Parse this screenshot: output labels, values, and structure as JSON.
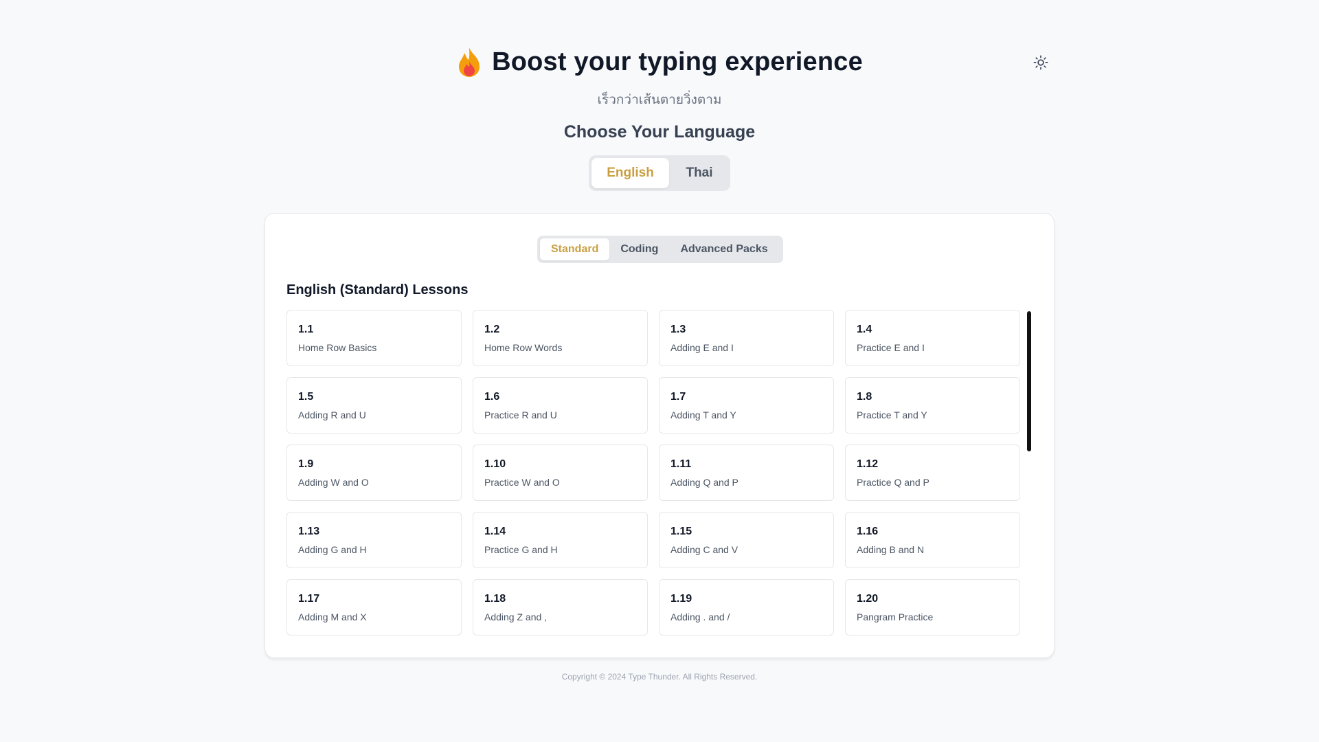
{
  "header": {
    "title": "Boost your typing experience",
    "subtitle": "เร็วกว่าเส้นตายวิ่งตาม",
    "flame_icon": "flame-icon",
    "theme_icon": "sun-icon"
  },
  "language": {
    "heading": "Choose Your Language",
    "options": [
      "English",
      "Thai"
    ],
    "selected": "English"
  },
  "categories": {
    "tabs": [
      "Standard",
      "Coding",
      "Advanced Packs"
    ],
    "selected": "Standard"
  },
  "lessons": {
    "section_title": "English (Standard) Lessons",
    "items": [
      {
        "id": "1.1",
        "title": "Home Row Basics"
      },
      {
        "id": "1.2",
        "title": "Home Row Words"
      },
      {
        "id": "1.3",
        "title": "Adding E and I"
      },
      {
        "id": "1.4",
        "title": "Practice E and I"
      },
      {
        "id": "1.5",
        "title": "Adding R and U"
      },
      {
        "id": "1.6",
        "title": "Practice R and U"
      },
      {
        "id": "1.7",
        "title": "Adding T and Y"
      },
      {
        "id": "1.8",
        "title": "Practice T and Y"
      },
      {
        "id": "1.9",
        "title": "Adding W and O"
      },
      {
        "id": "1.10",
        "title": "Practice W and O"
      },
      {
        "id": "1.11",
        "title": "Adding Q and P"
      },
      {
        "id": "1.12",
        "title": "Practice Q and P"
      },
      {
        "id": "1.13",
        "title": "Adding G and H"
      },
      {
        "id": "1.14",
        "title": "Practice G and H"
      },
      {
        "id": "1.15",
        "title": "Adding C and V"
      },
      {
        "id": "1.16",
        "title": "Adding B and N"
      },
      {
        "id": "1.17",
        "title": "Adding M and X"
      },
      {
        "id": "1.18",
        "title": "Adding Z and ,"
      },
      {
        "id": "1.19",
        "title": "Adding . and /"
      },
      {
        "id": "1.20",
        "title": "Pangram Practice"
      }
    ]
  },
  "footer": {
    "copyright": "Copyright © 2024 Type Thunder. All Rights Reserved."
  },
  "colors": {
    "accent": "#c9a040",
    "background": "#f8f9fb",
    "flame_outer": "#f59e0b",
    "flame_inner": "#ef4444"
  }
}
